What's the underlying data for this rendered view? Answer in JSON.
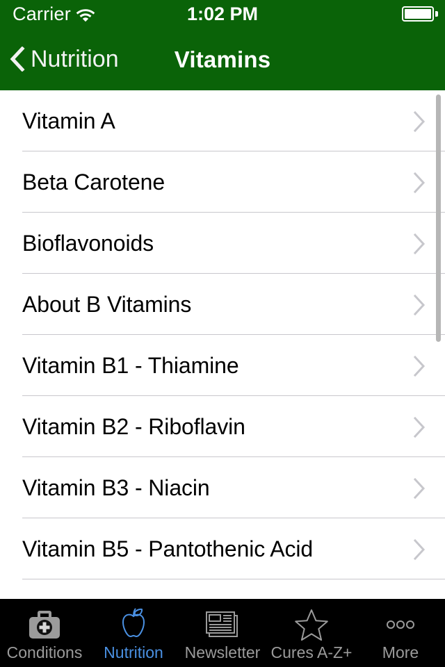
{
  "status_bar": {
    "carrier": "Carrier",
    "wifi_icon": "wifi-icon",
    "time": "1:02 PM",
    "battery_icon": "battery-full-icon"
  },
  "nav_bar": {
    "back_icon": "chevron-left-icon",
    "back_label": "Nutrition",
    "title": "Vitamins",
    "background_color": "#0a6308"
  },
  "list": {
    "disclosure_icon": "chevron-right-icon",
    "items": [
      {
        "label": "Vitamin A"
      },
      {
        "label": "Beta Carotene"
      },
      {
        "label": "Bioflavonoids"
      },
      {
        "label": "About B Vitamins"
      },
      {
        "label": "Vitamin B1 - Thiamine"
      },
      {
        "label": "Vitamin B2 - Riboflavin"
      },
      {
        "label": "Vitamin B3 - Niacin"
      },
      {
        "label": "Vitamin B5 - Pantothenic Acid"
      }
    ]
  },
  "tab_bar": {
    "active_color": "#4a90e2",
    "inactive_color": "#9b9b9b",
    "background_color": "#000000",
    "tabs": [
      {
        "label": "Conditions",
        "icon": "medical-bag-icon",
        "active": false
      },
      {
        "label": "Nutrition",
        "icon": "apple-icon",
        "active": true
      },
      {
        "label": "Newsletter",
        "icon": "newspaper-icon",
        "active": false
      },
      {
        "label": "Cures A-Z+",
        "icon": "star-icon",
        "active": false
      },
      {
        "label": "More",
        "icon": "ellipsis-icon",
        "active": false
      }
    ]
  }
}
